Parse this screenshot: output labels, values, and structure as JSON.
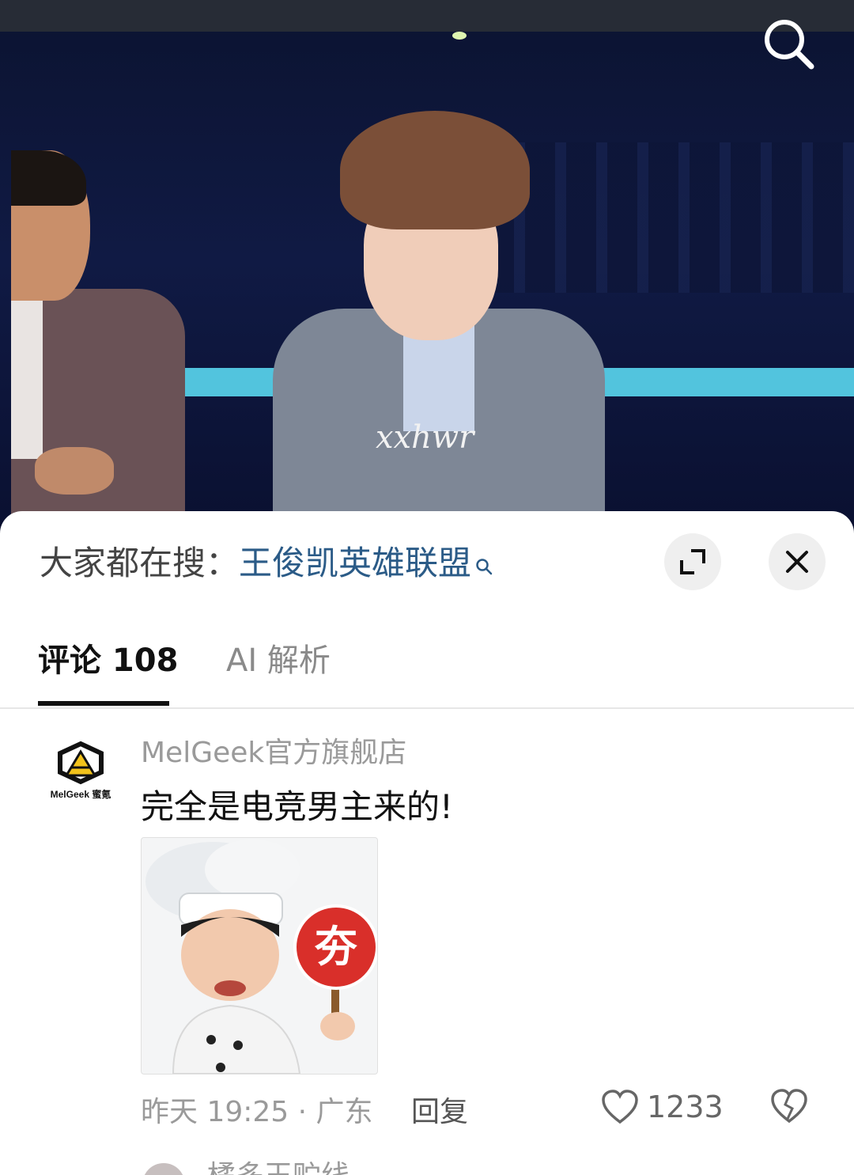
{
  "video": {
    "watermark": "xxhwr"
  },
  "hot_search": {
    "prefix": "大家都在搜：",
    "term": "王俊凯英雄联盟"
  },
  "tabs": [
    {
      "label": "评论 108",
      "active": true
    },
    {
      "label": "AI 解析",
      "active": false
    }
  ],
  "comment": {
    "author": "MelGeek官方旗舰店",
    "avatar_text": "MelGeek 蜜氪",
    "text": "完全是电竞男主来的!",
    "sticker_char": "夯",
    "time_location": "昨天 19:25 · 广东",
    "reply_label": "回复",
    "likes": "1233"
  },
  "next_comment": {
    "author": "橘多玉贮线"
  },
  "colors": {
    "hot_term": "#2b5b87",
    "sticker_badge": "#d92f2a",
    "logo_yellow": "#f2c21b"
  }
}
